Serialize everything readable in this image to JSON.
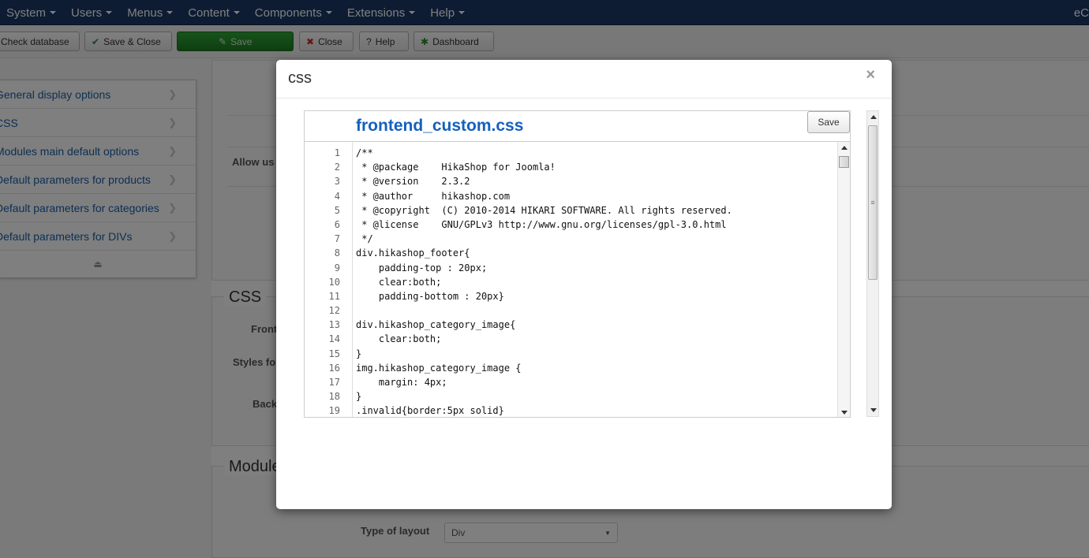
{
  "topnav": {
    "items": [
      "System",
      "Users",
      "Menus",
      "Content",
      "Components",
      "Extensions",
      "Help"
    ],
    "brand": "eC"
  },
  "toolbar": {
    "check_database": "Check database",
    "save_close": "Save & Close",
    "save": "Save",
    "close": "Close",
    "help": "Help",
    "dashboard": "Dashboard"
  },
  "sidebar": {
    "items": [
      "General display options",
      "CSS",
      "Modules main default options",
      "Default parameters for products",
      "Default parameters for categories",
      "Default parameters for DIVs"
    ]
  },
  "background": {
    "allow_label": "Allow us",
    "css_legend": "CSS",
    "front_label": "Front",
    "styles_label": "Styles fo",
    "back_label": "Back",
    "modules_legend": "Module",
    "type_of_layout_label": "Type of layout",
    "type_of_layout_value": "Div"
  },
  "modal": {
    "title": "css",
    "close": "×",
    "file_name": "frontend_custom.css",
    "save_label": "Save",
    "line_numbers": [
      "1",
      "2",
      "3",
      "4",
      "5",
      "6",
      "7",
      "8",
      "9",
      "10",
      "11",
      "12",
      "13",
      "14",
      "15",
      "16",
      "17",
      "18",
      "19"
    ],
    "code_lines": [
      "/**",
      " * @package    HikaShop for Joomla!",
      " * @version    2.3.2",
      " * @author     hikashop.com",
      " * @copyright  (C) 2010-2014 HIKARI SOFTWARE. All rights reserved.",
      " * @license    GNU/GPLv3 http://www.gnu.org/licenses/gpl-3.0.html",
      " */",
      "div.hikashop_footer{",
      "    padding-top : 20px;",
      "    clear:both;",
      "    padding-bottom : 20px}",
      "",
      "div.hikashop_category_image{",
      "    clear:both;",
      "}",
      "img.hikashop_category_image {",
      "    margin: 4px;",
      "}",
      ".invalid{border:5px solid}"
    ]
  }
}
